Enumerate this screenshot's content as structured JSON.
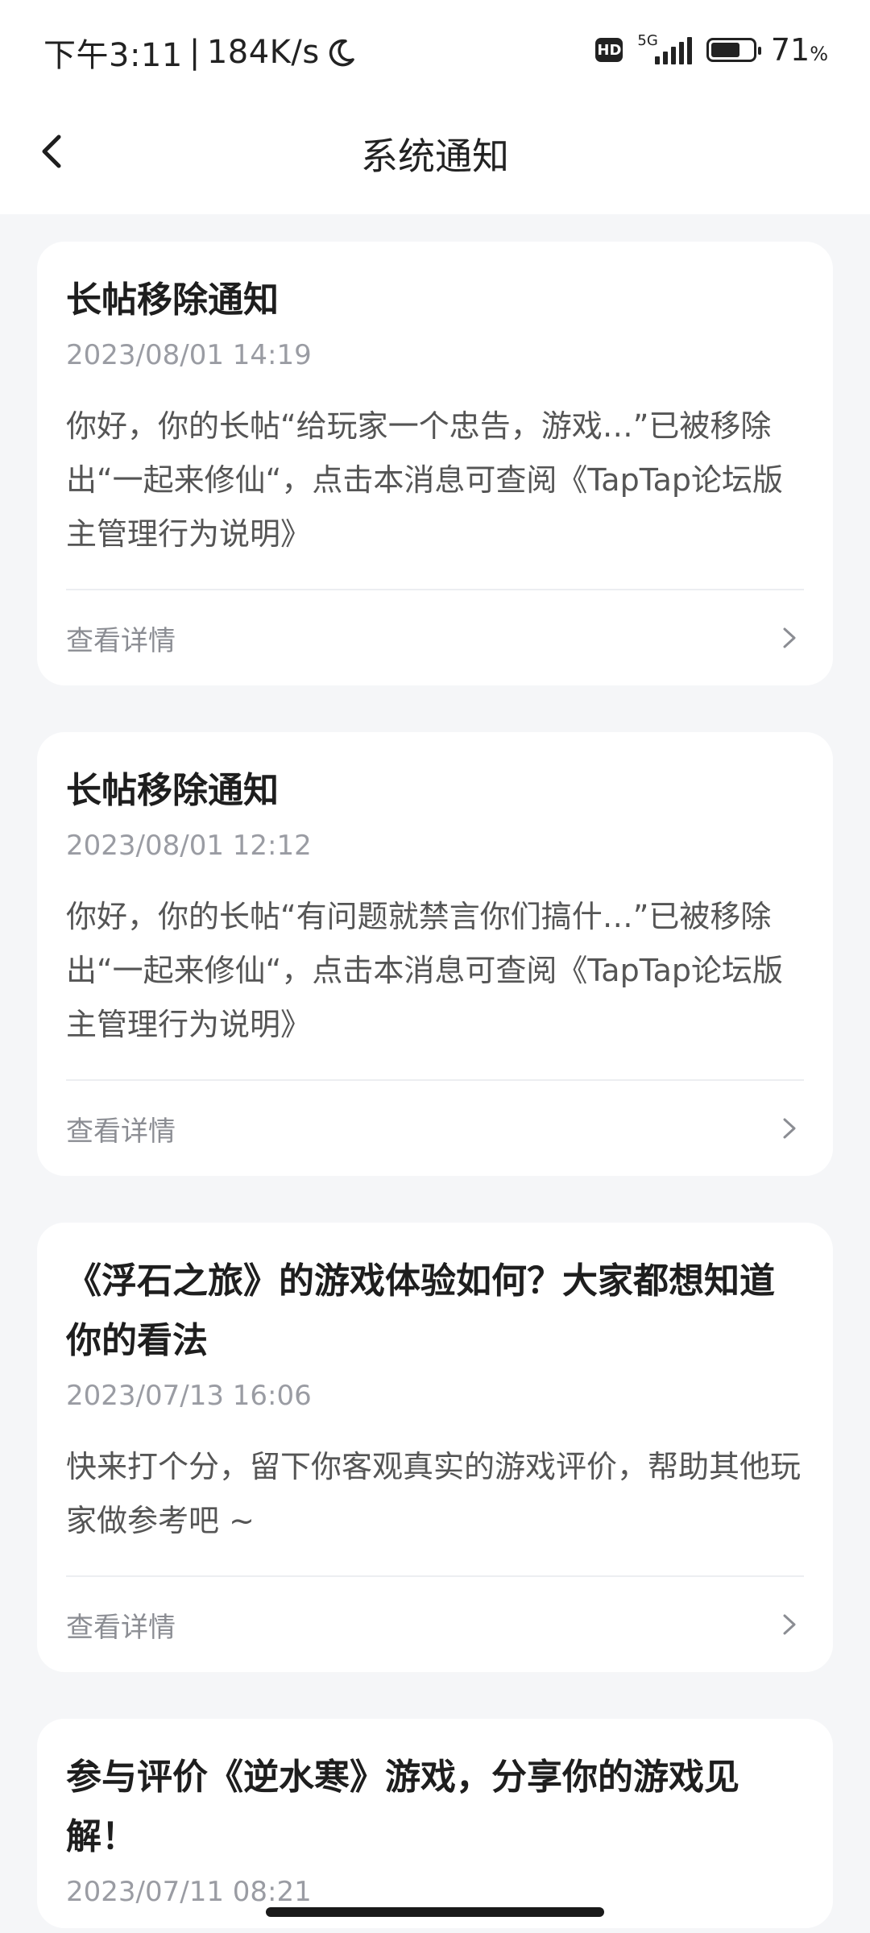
{
  "status_bar": {
    "time": "下午3:11",
    "separator": "|",
    "speed": "184K/s",
    "moon_icon": "moon-icon",
    "hd": "HD",
    "network": "5G",
    "battery_level": 0.71,
    "battery_percent": "71",
    "percent_sign": "%"
  },
  "header": {
    "title": "系统通知",
    "back_icon": "chevron-left-icon"
  },
  "notifications": [
    {
      "title": "长帖移除通知",
      "time": "2023/08/01 14:19",
      "body": "你好，你的长帖“给玩家一个忠告，游戏…”已被移除出“一起来修仙“，点击本消息可查阅《TapTap论坛版主管理行为说明》",
      "detail_label": "查看详情"
    },
    {
      "title": "长帖移除通知",
      "time": "2023/08/01 12:12",
      "body": "你好，你的长帖“有问题就禁言你们搞什…”已被移除出“一起来修仙“，点击本消息可查阅《TapTap论坛版主管理行为说明》",
      "detail_label": "查看详情"
    },
    {
      "title": "《浮石之旅》的游戏体验如何？大家都想知道你的看法",
      "time": "2023/07/13 16:06",
      "body": "快来打个分，留下你客观真实的游戏评价，帮助其他玩家做参考吧 ~",
      "detail_label": "查看详情"
    },
    {
      "title": "参与评价《逆水寒》游戏，分享你的游戏见解！",
      "time": "2023/07/11 08:21"
    }
  ],
  "colors": {
    "background": "#f5f6f8",
    "card": "#ffffff",
    "muted_text": "#9a9ca3"
  }
}
